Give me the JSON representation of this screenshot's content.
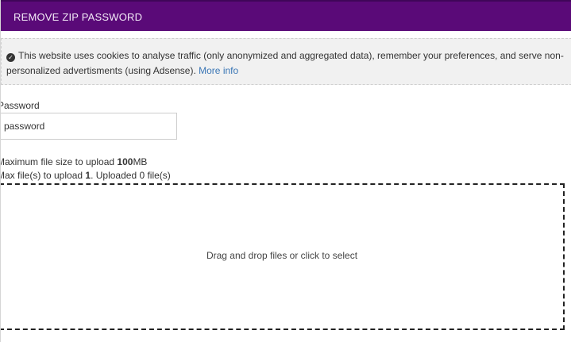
{
  "header": {
    "title": "REMOVE ZIP PASSWORD"
  },
  "cookie_notice": {
    "icon": "check-circle-icon",
    "text": "This website uses cookies to analyse traffic (only anonymized and aggregated data), remember your preferences, and serve non-personalized advertisments (using Adsense).",
    "link_label": "More info"
  },
  "password": {
    "label": "Password",
    "value": "password"
  },
  "upload_info": {
    "max_size_prefix": "Maximum file size to upload ",
    "max_size_value": "100",
    "max_size_unit": "MB",
    "max_files_prefix": "Max file(s) to upload ",
    "max_files_value": "1",
    "max_files_suffix": ". Uploaded 0 file(s)"
  },
  "dropzone": {
    "text": "Drag and drop files or click to select"
  },
  "colors": {
    "header_bg": "#5a0a78",
    "link": "#3a76b5",
    "notice_bg": "#f1f1f1"
  }
}
